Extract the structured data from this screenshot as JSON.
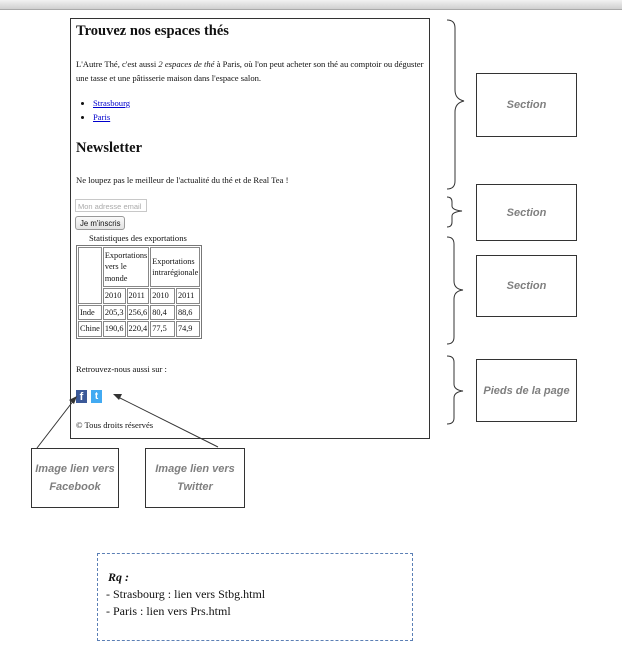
{
  "mockup": {
    "title": "Trouvez nos espaces thés",
    "intro_before": "L'Autre Thé, c'est aussi ",
    "intro_em": "2 espaces de thé",
    "intro_after": " à Paris, où l'on peut acheter son thé au comptoir ou déguster une tasse et une pâtisserie maison dans l'espace salon.",
    "links": [
      "Strasbourg",
      "Paris"
    ],
    "newsletter_title": "Newsletter",
    "newsletter_text": "Ne loupez pas le meilleur de l'actualité du thé et de Real Tea !",
    "email_placeholder": "Mon adresse email",
    "subscribe_label": "Je m'inscris",
    "table_caption": "Statistiques des exportations",
    "table": {
      "header_world": "Exportations vers le monde",
      "header_regional": "Exportations intrarégionale",
      "years": [
        "2010",
        "2011",
        "2010",
        "2011"
      ],
      "rows": [
        {
          "country": "Inde",
          "values": [
            "205,3",
            "256,6",
            "80,4",
            "88,6"
          ]
        },
        {
          "country": "Chine",
          "values": [
            "190,6",
            "220,4",
            "77,5",
            "74,9"
          ]
        }
      ]
    },
    "follow_text": "Retrouvez-nous aussi sur :",
    "facebook_glyph": "f",
    "twitter_glyph": "t",
    "copyright": "© Tous droits réservés"
  },
  "annotations": {
    "section_1": "Section",
    "section_2": "Section",
    "section_3": "Section",
    "footer": "Pieds de la page",
    "facebook": "Image lien vers Facebook",
    "twitter": "Image lien vers Twitter"
  },
  "note": {
    "title": "Rq :",
    "line1": "- Strasbourg : lien vers Stbg.html",
    "line2": "- Paris : lien vers Prs.html"
  }
}
